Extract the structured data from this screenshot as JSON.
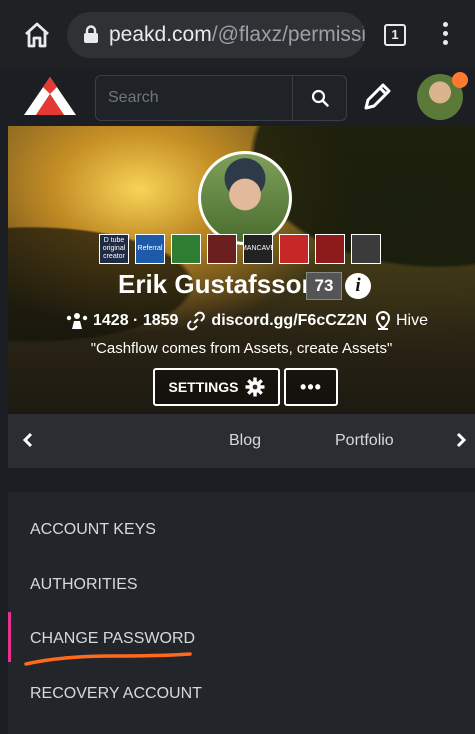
{
  "browser": {
    "url_domain": "peakd.com",
    "url_path": "/@flaxz/permissi",
    "tab_count": "1"
  },
  "topbar": {
    "search_placeholder": "Search"
  },
  "profile": {
    "display_name": "Erik Gustafsson",
    "reputation": "73",
    "followers": "1428",
    "separator": "·",
    "following": "1859",
    "website": "discord.gg/F6cCZ2N",
    "location": "Hive",
    "about": "\"Cashflow comes from Assets, create Assets\"",
    "badges": [
      {
        "label": "D tube original creator",
        "color": "#1f2a44"
      },
      {
        "label": "Referral",
        "color": "#1e5aa8"
      },
      {
        "label": "",
        "color": "#2f7d32"
      },
      {
        "label": "",
        "color": "#6b1f1f"
      },
      {
        "label": "MANCAVE",
        "color": "#222"
      },
      {
        "label": "",
        "color": "#c62828"
      },
      {
        "label": "",
        "color": "#8e1b1b"
      },
      {
        "label": "",
        "color": "#3b3b3b"
      }
    ]
  },
  "actions": {
    "settings_label": "SETTINGS",
    "more_label": "•••"
  },
  "tabs": [
    "Blog",
    "Portfolio"
  ],
  "settings_menu": {
    "items": [
      "ACCOUNT KEYS",
      "AUTHORITIES",
      "CHANGE PASSWORD",
      "RECOVERY ACCOUNT"
    ],
    "active": "CHANGE PASSWORD",
    "accent_color": "#e8318f",
    "annotation_color": "#ff6a1a"
  }
}
